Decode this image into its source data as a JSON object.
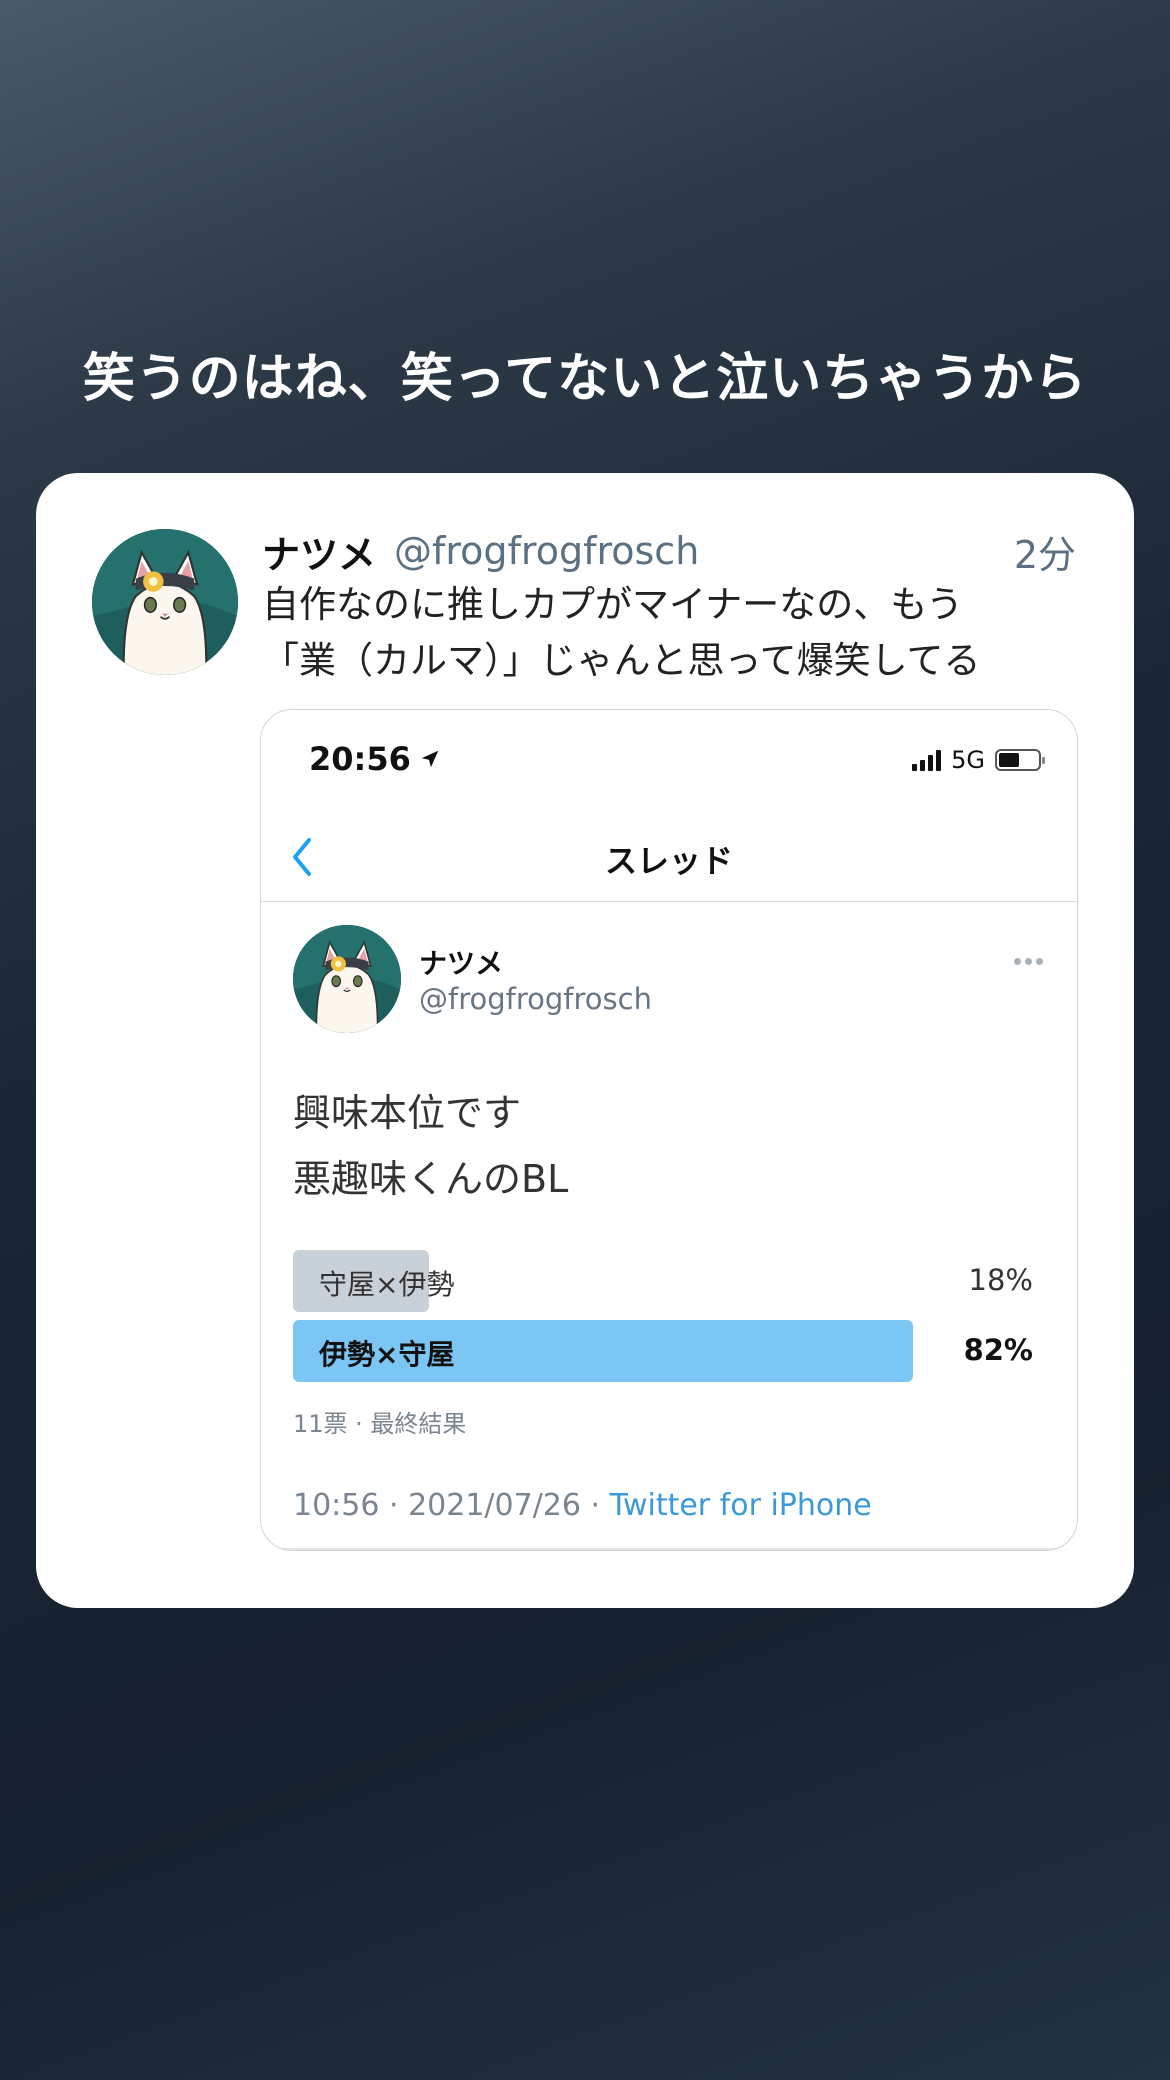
{
  "caption": "笑うのはね、笑ってないと泣いちゃうから",
  "tweet": {
    "name": "ナツメ",
    "handle": "@frogfrogfrosch",
    "time": "2分",
    "body_lines": [
      "自作なのに推しカプがマイナーなの、もう",
      "「業（カルマ）」じゃんと思って爆笑してる"
    ],
    "avatar_icon": "cat-avatar-icon"
  },
  "screenshot": {
    "status_time": "20:56",
    "network": "5G",
    "nav_title": "スレッド",
    "post": {
      "name": "ナツメ",
      "handle": "@frogfrogfrosch",
      "body_lines": [
        "興味本位です",
        "悪趣味くんのBL"
      ]
    },
    "poll": {
      "options": [
        {
          "label": "守屋×伊勢",
          "percent_text": "18%",
          "percent": 18
        },
        {
          "label": "伊勢×守屋",
          "percent_text": "82%",
          "percent": 82
        }
      ],
      "meta": "11票 · 最終結果"
    },
    "timestamp": "10:56 · 2021/07/26 · ",
    "source": "Twitter for iPhone",
    "colors": {
      "accent": "#1da1f2",
      "winner_bar": "#7cc6f5",
      "loser_bar": "#c9d1d8"
    }
  }
}
